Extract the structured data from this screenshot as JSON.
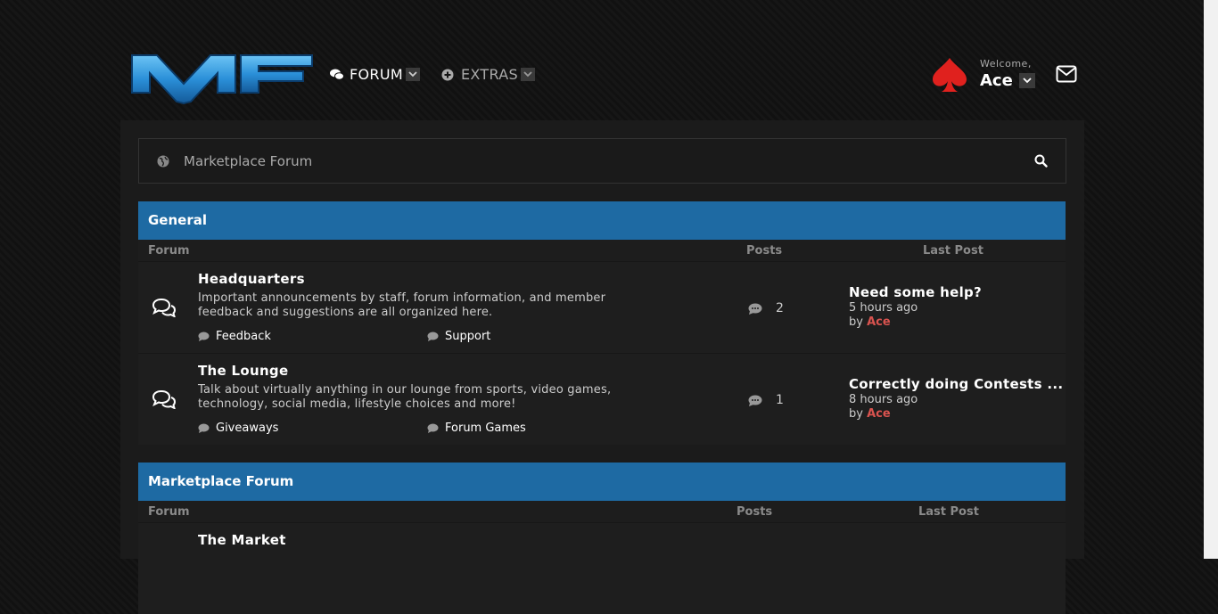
{
  "colors": {
    "accent": "#1e6aa3",
    "username_red": "#d9534f",
    "spade_red": "#e0211e"
  },
  "header": {
    "logo_text": "MF",
    "nav": [
      {
        "label": "FORUM",
        "icon": "comments-icon"
      },
      {
        "label": "EXTRAS",
        "icon": "plus-circle-icon"
      }
    ],
    "welcome": "Welcome,",
    "username": "Ace"
  },
  "search": {
    "breadcrumb": "Marketplace Forum"
  },
  "categories": [
    {
      "title": "General",
      "columns": {
        "forum": "Forum",
        "posts": "Posts",
        "last_post": "Last Post"
      },
      "forums": [
        {
          "title": "Headquarters",
          "description": "Important announcements by staff, forum information, and member feedback and suggestions are all organized here.",
          "subforums": [
            "Feedback",
            "Support"
          ],
          "posts": "2",
          "last_post": {
            "title": "Need some help?",
            "time": "5 hours ago",
            "by": "by",
            "user": "Ace"
          }
        },
        {
          "title": "The Lounge",
          "description": "Talk about virtually anything in our lounge from sports, video games, technology, social media, lifestyle choices and more!",
          "subforums": [
            "Giveaways",
            "Forum Games"
          ],
          "posts": "1",
          "last_post": {
            "title": "Correctly doing Contests ...",
            "time": "8 hours ago",
            "by": "by",
            "user": "Ace"
          }
        }
      ]
    },
    {
      "title": "Marketplace Forum",
      "columns": {
        "forum": "Forum",
        "posts": "Posts",
        "last_post": "Last Post"
      },
      "forums": [
        {
          "title": "The Market"
        }
      ]
    }
  ]
}
